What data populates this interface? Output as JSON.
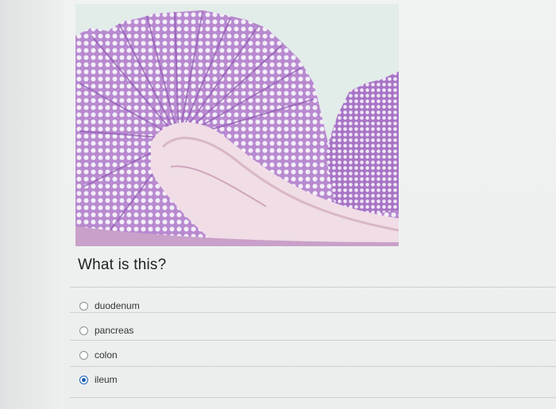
{
  "question": {
    "text": "What is this?"
  },
  "options": [
    {
      "label": "duodenum",
      "selected": false
    },
    {
      "label": "pancreas",
      "selected": false
    },
    {
      "label": "colon",
      "selected": false
    },
    {
      "label": "ileum",
      "selected": true
    }
  ],
  "colors": {
    "accent": "#1a5fb4",
    "tissue_stain": "#a776c4"
  }
}
